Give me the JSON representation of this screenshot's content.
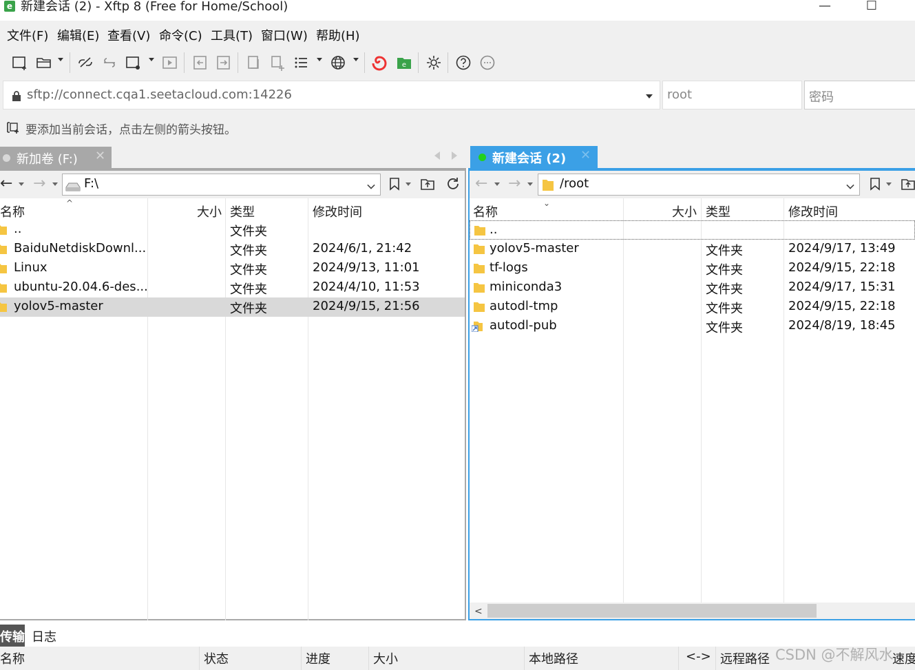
{
  "window": {
    "app_icon_letter": "e",
    "title": "新建会话 (2) - Xftp 8 (Free for Home/School)",
    "minimize": "—",
    "maximize": "☐"
  },
  "menu": [
    "文件(F)",
    "编辑(E)",
    "查看(V)",
    "命令(C)",
    "工具(T)",
    "窗口(W)",
    "帮助(H)"
  ],
  "address": {
    "url": "sftp://connect.cqa1.seetacloud.com:14226",
    "user": "root",
    "password_placeholder": "密码"
  },
  "hint": "要添加当前会话，点击左侧的箭头按钮。",
  "tabs": {
    "left": {
      "label": "新加卷 (F:)",
      "close": "✕"
    },
    "right": {
      "label": "新建会话 (2)",
      "close": "✕"
    }
  },
  "left_pane": {
    "path": "F:\\",
    "columns": [
      "名称",
      "大小",
      "类型",
      "修改时间"
    ],
    "sort_mark": "^",
    "rows": [
      {
        "name": "..",
        "size": "",
        "type": "文件夹",
        "modified": ""
      },
      {
        "name": "BaiduNetdiskDownl...",
        "size": "",
        "type": "文件夹",
        "modified": "2024/6/1, 21:42"
      },
      {
        "name": "Linux",
        "size": "",
        "type": "文件夹",
        "modified": "2024/9/13, 11:01"
      },
      {
        "name": "ubuntu-20.04.6-des...",
        "size": "",
        "type": "文件夹",
        "modified": "2024/4/10, 11:53"
      },
      {
        "name": "yolov5-master",
        "size": "",
        "type": "文件夹",
        "modified": "2024/9/15, 21:56"
      }
    ]
  },
  "right_pane": {
    "path": "/root",
    "columns": [
      "名称",
      "大小",
      "类型",
      "修改时间"
    ],
    "sort_mark": "⌄",
    "rows": [
      {
        "name": "..",
        "size": "",
        "type": "",
        "modified": ""
      },
      {
        "name": "yolov5-master",
        "size": "",
        "type": "文件夹",
        "modified": "2024/9/17, 13:49"
      },
      {
        "name": "tf-logs",
        "size": "",
        "type": "文件夹",
        "modified": "2024/9/15, 22:18"
      },
      {
        "name": "miniconda3",
        "size": "",
        "type": "文件夹",
        "modified": "2024/9/17, 15:31"
      },
      {
        "name": "autodl-tmp",
        "size": "",
        "type": "文件夹",
        "modified": "2024/9/15, 22:18"
      },
      {
        "name": "autodl-pub",
        "size": "",
        "type": "文件夹",
        "modified": "2024/8/19, 18:45"
      }
    ],
    "scroll_left": "<"
  },
  "bottom": {
    "tabs": [
      "传输",
      "日志"
    ],
    "columns": [
      "名称",
      "状态",
      "进度",
      "大小",
      "本地路径",
      "<->",
      "远程路径",
      "速度"
    ],
    "watermark": "CSDN @不解风水"
  },
  "colors": {
    "active_tab": "#3ba0e6",
    "inactive_tab": "#a8a8a8",
    "connected_dot": "#22d11e",
    "folder": "#f5c542"
  }
}
